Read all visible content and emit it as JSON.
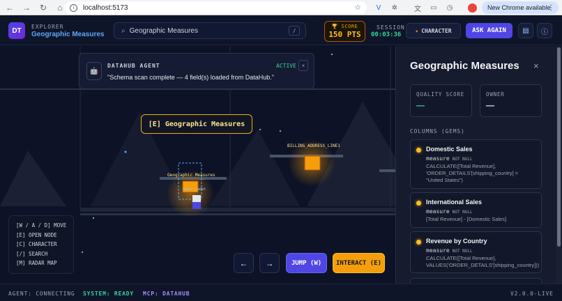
{
  "browser": {
    "url": "localhost:5173",
    "update_label": "New Chrome available"
  },
  "header": {
    "logo": "DT",
    "brand_small": "EXPLORER",
    "brand_title": "Geographic Measures",
    "search_value": "Geographic Measures",
    "search_key": "/",
    "score_label": "SCORE",
    "score_value": "150 PTS",
    "session_label": "SESSION",
    "session_value": "00:03:36",
    "character_label": "CHARACTER",
    "ask_label": "ASK AGAIN"
  },
  "toast": {
    "title": "DATAHUB AGENT",
    "status": "ACTIVE",
    "message": "\"Schema scan complete — 4 field(s) loaded from DataHub.\"",
    "close": "×"
  },
  "game": {
    "prompt": "[E] Geographic Measures",
    "node_label_1": "Geographic Measures",
    "node_label_2": "BILLING_ADDRESS_LINE1",
    "player_tag": "Cyber Cadet",
    "controls": [
      "[W / A / D] MOVE",
      "[E] OPEN NODE",
      "[C] CHARACTER",
      "[/] SEARCH",
      "[M] RADAR MAP"
    ],
    "left_btn": "←",
    "right_btn": "→",
    "jump_label": "JUMP (W)",
    "interact_label": "INTERACT (E)"
  },
  "panel": {
    "title": "Geographic Measures",
    "close": "×",
    "quality_label": "QUALITY SCORE",
    "quality_value": "—",
    "owner_label": "OWNER",
    "owner_value": "—",
    "columns_label": "COLUMNS (GEMS)",
    "columns": [
      {
        "name": "Domestic Sales",
        "type": "measure",
        "nullability": "NOT NULL",
        "expr": "CALCULATE([Total Revenue],\n'ORDER_DETAILS'[shipping_country] =\n\"United States\")"
      },
      {
        "name": "International Sales",
        "type": "measure",
        "nullability": "NOT NULL",
        "expr": "[Total Revenue] - [Domestic Sales]"
      },
      {
        "name": "Revenue by Country",
        "type": "measure",
        "nullability": "NOT NULL",
        "expr": "CALCULATE([Total Revenue],\nVALUES('ORDER_DETAILS'[shipping_country]))"
      }
    ]
  },
  "statusbar": {
    "agent": "AGENT: CONNECTING",
    "system": "SYSTEM: READY",
    "mcp": "MCP: DATAHUB",
    "version": "V2.0.0-LIVE"
  },
  "colors": {
    "accent": "#4f46e5",
    "score": "#fbbf24",
    "ready": "#34d399",
    "mcp": "#a78bfa",
    "quality": "#34d399"
  }
}
